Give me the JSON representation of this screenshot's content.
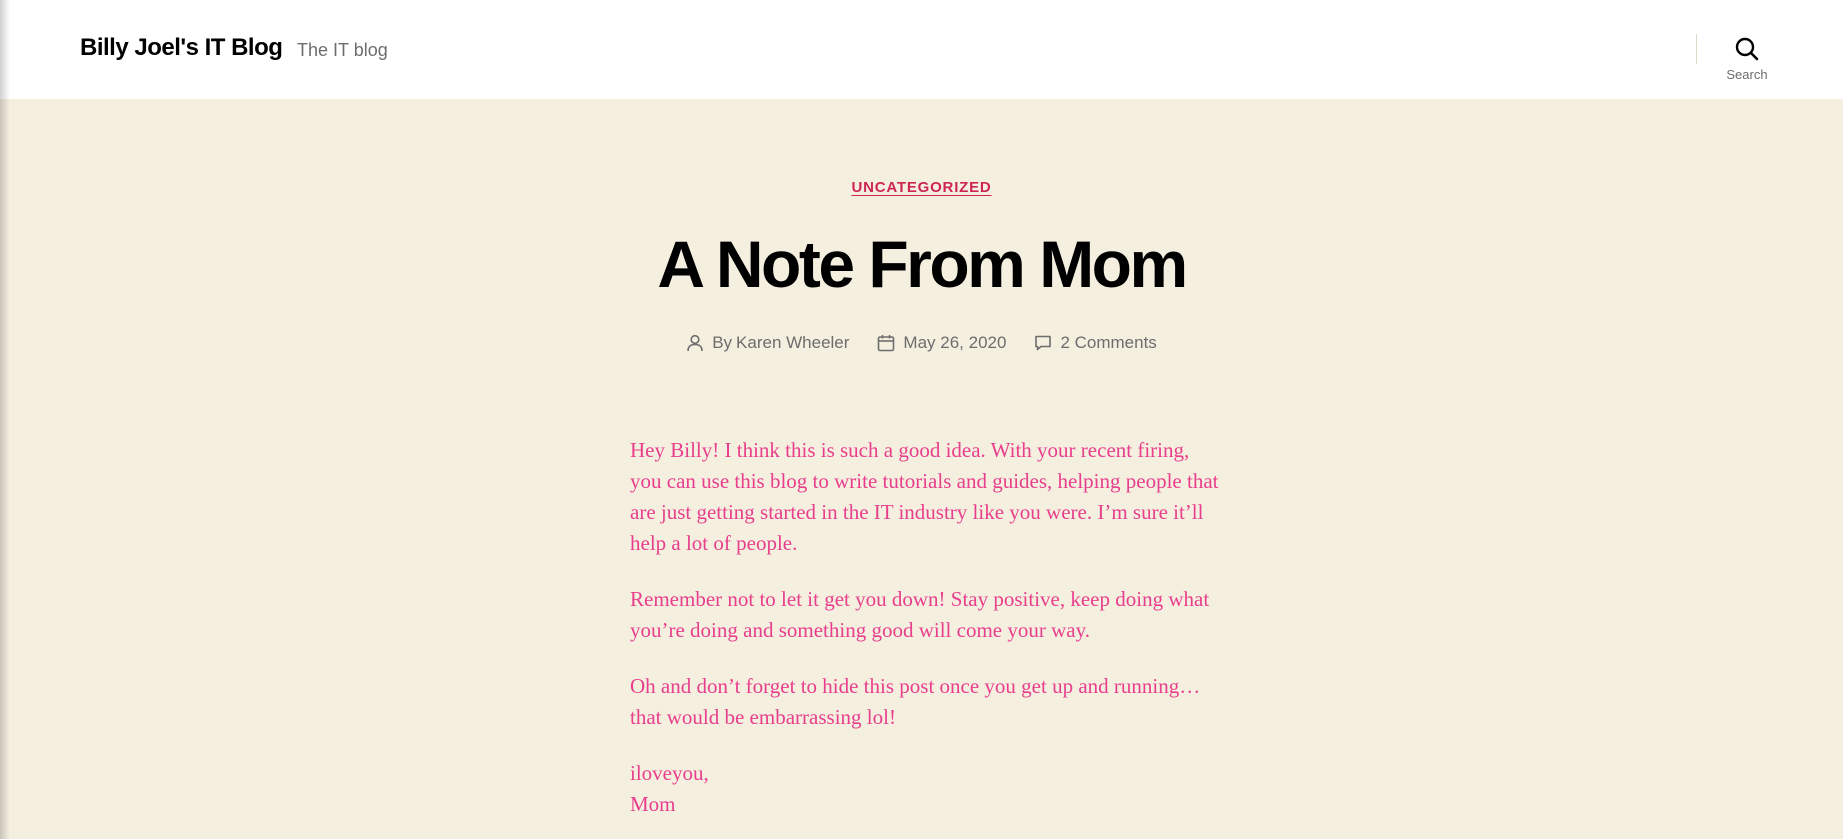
{
  "header": {
    "site_title": "Billy Joel's IT Blog",
    "site_description": "The IT blog",
    "search_label": "Search"
  },
  "post": {
    "category": "UNCATEGORIZED",
    "title": "A Note From Mom",
    "meta": {
      "author_prefix": "By",
      "author": "Karen Wheeler",
      "date": "May 26, 2020",
      "comments": "2 Comments"
    },
    "paragraphs": [
      "Hey Billy!  I think this is such a good idea.  With your recent firing, you can use this blog to write tutorials and guides, helping people that are just getting started in the IT industry like you were.  I’m sure it’ll help a lot of people.",
      "Remember not to let it get you down!  Stay positive, keep doing what you’re doing and something good will come your way.",
      "Oh and don’t forget to hide this post once you get up and running…that would be embarrassing lol!"
    ],
    "closing": {
      "line1": "iloveyou,",
      "line2": "Mom"
    }
  },
  "colors": {
    "accent": "#cd2653",
    "content_text": "#e83e8c",
    "background": "#f5efe0",
    "header_background": "#ffffff",
    "meta_text": "#6d6d6d"
  },
  "icons": {
    "search": "search-icon",
    "author": "user-icon",
    "date": "calendar-icon",
    "comments": "comment-icon"
  }
}
